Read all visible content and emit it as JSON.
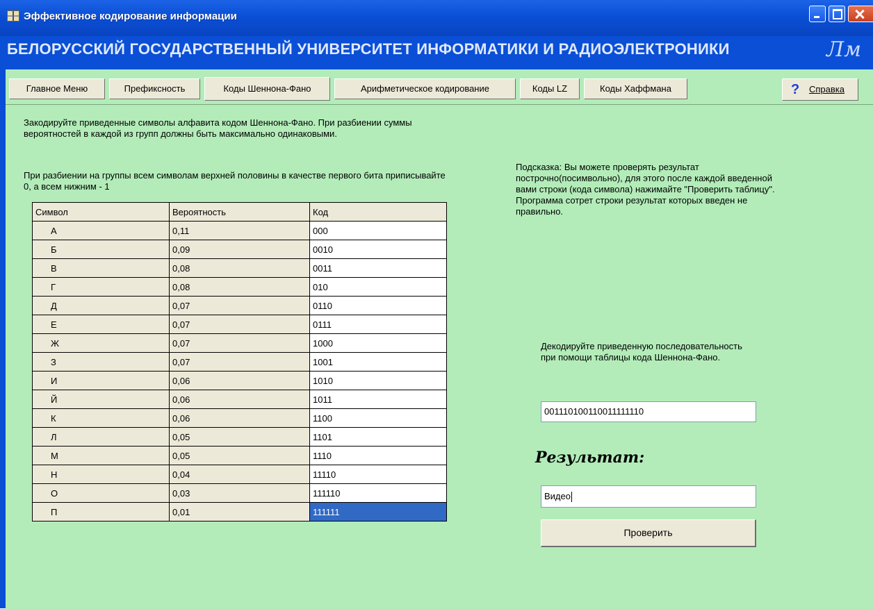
{
  "window": {
    "title": "Эффективное кодирование информации",
    "banner": "БЕЛОРУССКИЙ ГОСУДАРСТВЕННЫЙ УНИВЕРСИТЕТ ИНФОРМАТИКИ И РАДИОЭЛЕКТРОНИКИ",
    "logo_text": "Лм"
  },
  "tabs": {
    "main": "Главное Меню",
    "prefix": "Префиксность",
    "shannon": "Коды Шеннона-Фано",
    "arith": "Арифметическое кодирование",
    "lz": "Коды LZ",
    "huffman": "Коды Хаффмана",
    "active": "Коды Шеннона-Фано"
  },
  "help": {
    "icon": "question-icon",
    "label": "Справка"
  },
  "instructions": {
    "encode": "Закодируйте приведенные символы алфавита кодом Шеннона-Фано. При разбиении суммы вероятностей в каждой из групп должны быть максимально одинаковыми.",
    "groups": "При разбиении на группы всем символам верхней половины в качестве первого бита приписывайте 0, а всем нижним - 1",
    "hint": "Подсказка: Вы можете проверять результат построчно(посимвольно), для этого после каждой введенной вами строки (кода символа) нажимайте \"Проверить таблицу\". Программа сотрет строки результат которых введен не правильно.",
    "decode": "Декодируйте приведенную последовательность при помощи таблицы кода Шеннона-Фано."
  },
  "table": {
    "headers": [
      "Символ",
      "Вероятность",
      "Код"
    ],
    "rows": [
      [
        "А",
        "0,11",
        "000"
      ],
      [
        "Б",
        "0,09",
        "0010"
      ],
      [
        "В",
        "0,08",
        "0011"
      ],
      [
        "Г",
        "0,08",
        "010"
      ],
      [
        "Д",
        "0,07",
        "0110"
      ],
      [
        "Е",
        "0,07",
        "0111"
      ],
      [
        "Ж",
        "0,07",
        "1000"
      ],
      [
        "З",
        "0,07",
        "1001"
      ],
      [
        "И",
        "0,06",
        "1010"
      ],
      [
        "Й",
        "0,06",
        "1011"
      ],
      [
        "К",
        "0,06",
        "1100"
      ],
      [
        "Л",
        "0,05",
        "1101"
      ],
      [
        "М",
        "0,05",
        "1110"
      ],
      [
        "Н",
        "0,04",
        "11110"
      ],
      [
        "О",
        "0,03",
        "111110"
      ],
      [
        "П",
        "0,01",
        "111111"
      ]
    ],
    "selected_row": 15
  },
  "decode": {
    "sequence": "001110100110011111110",
    "result_label": "Результат:",
    "result_value": "Видео",
    "check_button": "Проверить"
  },
  "colors": {
    "panel_background": "#b3ecb9",
    "titlebar": "#0a4fd6",
    "selection": "#316ac5",
    "button_face": "#ece9d8"
  }
}
